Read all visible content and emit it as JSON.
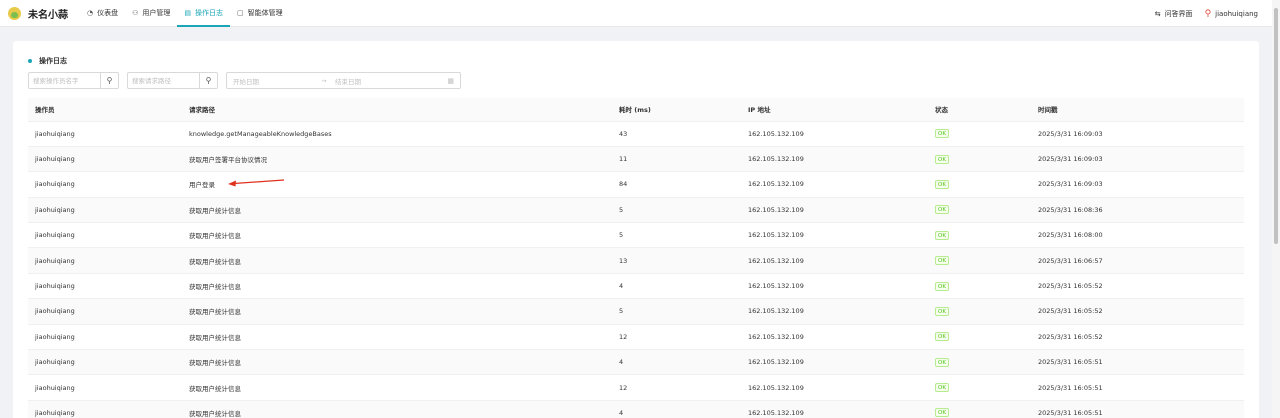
{
  "app": {
    "brand": "未名小蒜"
  },
  "nav": [
    {
      "label": "仪表盘",
      "icon": "dashboard-icon"
    },
    {
      "label": "用户管理",
      "icon": "users-icon"
    },
    {
      "label": "操作日志",
      "icon": "document-icon",
      "active": true
    },
    {
      "label": "智能体管理",
      "icon": "agent-icon"
    }
  ],
  "header_right": {
    "qa_label": "问答界面",
    "username": "jiaohuiqiang"
  },
  "card": {
    "title": "操作日志"
  },
  "filters": {
    "operator_placeholder": "搜索操作员名字",
    "path_placeholder": "搜索请求路径",
    "date_start_placeholder": "开始日期",
    "date_end_placeholder": "结束日期"
  },
  "table": {
    "columns": [
      "操作员",
      "请求路径",
      "耗时 (ms)",
      "IP 地址",
      "状态",
      "时间戳"
    ],
    "rows": [
      {
        "operator": "jiaohuiqiang",
        "path": "knowledge.getManageableKnowledgeBases",
        "duration": "43",
        "ip": "162.105.132.109",
        "status": "OK",
        "time": "2025/3/31 16:09:03"
      },
      {
        "operator": "jiaohuiqiang",
        "path": "获取用户签署平台协议情况",
        "duration": "11",
        "ip": "162.105.132.109",
        "status": "OK",
        "time": "2025/3/31 16:09:03"
      },
      {
        "operator": "jiaohuiqiang",
        "path": "用户登录",
        "duration": "84",
        "ip": "162.105.132.109",
        "status": "OK",
        "time": "2025/3/31 16:09:03"
      },
      {
        "operator": "jiaohuiqiang",
        "path": "获取用户统计信息",
        "duration": "5",
        "ip": "162.105.132.109",
        "status": "OK",
        "time": "2025/3/31 16:08:36"
      },
      {
        "operator": "jiaohuiqiang",
        "path": "获取用户统计信息",
        "duration": "5",
        "ip": "162.105.132.109",
        "status": "OK",
        "time": "2025/3/31 16:08:00"
      },
      {
        "operator": "jiaohuiqiang",
        "path": "获取用户统计信息",
        "duration": "13",
        "ip": "162.105.132.109",
        "status": "OK",
        "time": "2025/3/31 16:06:57"
      },
      {
        "operator": "jiaohuiqiang",
        "path": "获取用户统计信息",
        "duration": "4",
        "ip": "162.105.132.109",
        "status": "OK",
        "time": "2025/3/31 16:05:52"
      },
      {
        "operator": "jiaohuiqiang",
        "path": "获取用户统计信息",
        "duration": "5",
        "ip": "162.105.132.109",
        "status": "OK",
        "time": "2025/3/31 16:05:52"
      },
      {
        "operator": "jiaohuiqiang",
        "path": "获取用户统计信息",
        "duration": "12",
        "ip": "162.105.132.109",
        "status": "OK",
        "time": "2025/3/31 16:05:52"
      },
      {
        "operator": "jiaohuiqiang",
        "path": "获取用户统计信息",
        "duration": "4",
        "ip": "162.105.132.109",
        "status": "OK",
        "time": "2025/3/31 16:05:51"
      },
      {
        "operator": "jiaohuiqiang",
        "path": "获取用户统计信息",
        "duration": "12",
        "ip": "162.105.132.109",
        "status": "OK",
        "time": "2025/3/31 16:05:51"
      },
      {
        "operator": "jiaohuiqiang",
        "path": "获取用户统计信息",
        "duration": "4",
        "ip": "162.105.132.109",
        "status": "OK",
        "time": "2025/3/31 16:05:51"
      }
    ]
  },
  "colors": {
    "accent": "#1aa6b7",
    "ok": "#52c41a",
    "annotation": "#e0301e"
  }
}
